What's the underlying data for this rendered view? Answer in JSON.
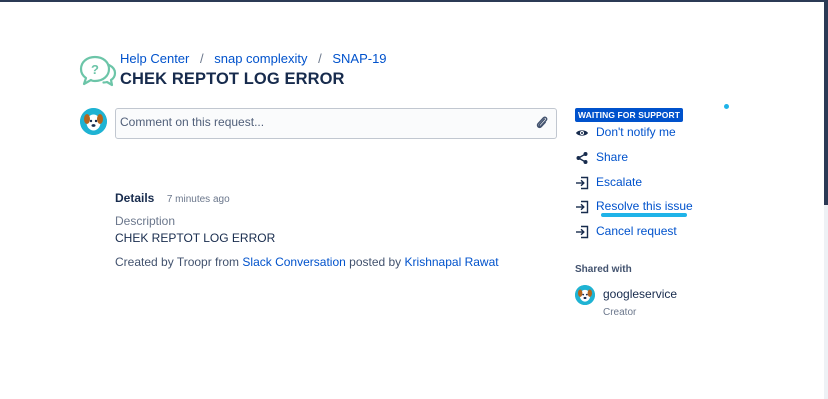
{
  "breadcrumb": {
    "items": [
      "Help Center",
      "snap complexity",
      "SNAP-19"
    ],
    "separator": "/"
  },
  "request": {
    "title": "CHEK REPTOT LOG ERROR"
  },
  "comment": {
    "placeholder": "Comment on this request..."
  },
  "details": {
    "label": "Details",
    "time": "7 minutes ago",
    "description_label": "Description",
    "description_value": "CHEK REPTOT LOG ERROR",
    "created_prefix": "Created by Troopr from",
    "created_source": "Slack Conversation",
    "created_middle": "posted by",
    "created_author": "Krishnapal Rawat"
  },
  "sidebar": {
    "status": "WAITING FOR SUPPORT",
    "actions": [
      {
        "label": "Don't notify me",
        "icon": "eye-icon"
      },
      {
        "label": "Share",
        "icon": "share-icon"
      },
      {
        "label": "Escalate",
        "icon": "transition-icon"
      },
      {
        "label": "Resolve this issue",
        "icon": "transition-icon"
      },
      {
        "label": "Cancel request",
        "icon": "transition-icon"
      }
    ],
    "shared_with_label": "Shared with",
    "participant": {
      "name": "googleservice",
      "role": "Creator"
    }
  },
  "colors": {
    "link": "#0052cc",
    "text": "#172b4d",
    "lozenge": "#0052cc",
    "highlight": "#1fb3e8",
    "avatar": "#1fb3d3"
  }
}
